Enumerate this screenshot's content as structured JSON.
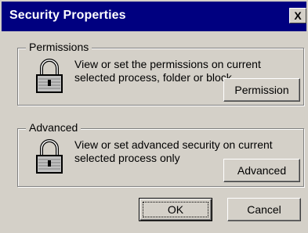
{
  "window": {
    "title": "Security Properties",
    "close_label": "X"
  },
  "permissions": {
    "legend": "Permissions",
    "description": "View or set the permissions on current selected process, folder or block",
    "button_label": "Permission",
    "icon": "lock-icon"
  },
  "advanced": {
    "legend": "Advanced",
    "description": "View or set advanced security on current selected process only",
    "button_label": "Advanced",
    "icon": "lock-icon"
  },
  "footer": {
    "ok_label": "OK",
    "cancel_label": "Cancel"
  },
  "colors": {
    "titlebar": "#000080",
    "face": "#d4d0c8"
  }
}
